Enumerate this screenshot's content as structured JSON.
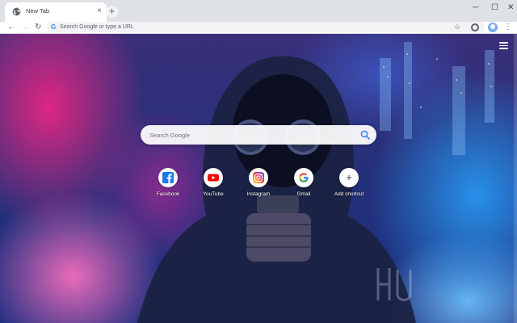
{
  "tab": {
    "title": "New Tab",
    "close_glyph": "×",
    "favicon": "globe-icon"
  },
  "new_tab_glyph": "+",
  "window": {
    "minimize": "─",
    "maximize": "☐",
    "close": "✕"
  },
  "toolbar": {
    "back_glyph": "←",
    "forward_glyph": "→",
    "reload_glyph": "↻",
    "google_glyph": "G",
    "omnibox_placeholder": "Search Google or type a URL",
    "star_glyph": "☆",
    "menu_glyph": "⋮"
  },
  "search": {
    "placeholder": "Search Google",
    "icon": "search-icon"
  },
  "shortcuts": [
    {
      "label": "Facebook",
      "icon": "facebook-icon",
      "color": "#1877f2"
    },
    {
      "label": "YouTube",
      "icon": "youtube-icon",
      "color": "#ff0000"
    },
    {
      "label": "Instagram",
      "icon": "instagram-icon",
      "color": "#c13584"
    },
    {
      "label": "Gmail",
      "icon": "google-icon",
      "color": "#4285f4"
    },
    {
      "label": "Add shortcut",
      "icon": "plus-icon",
      "glyph": "+"
    }
  ],
  "colors": {
    "tabstrip": "#dee1e6",
    "accent_pink": "#e82682",
    "accent_blue": "#2896f0"
  }
}
